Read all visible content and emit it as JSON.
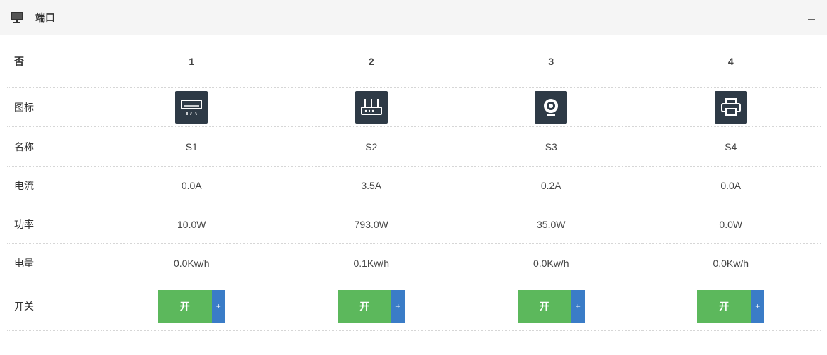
{
  "panel": {
    "title": "端口",
    "header_icon": "monitor-icon",
    "collapse_label": "–"
  },
  "rows": {
    "index": "否",
    "icon": "图标",
    "name": "名称",
    "current": "电流",
    "power": "功率",
    "energy": "电量",
    "switch": "开关"
  },
  "ports": [
    {
      "index": "1",
      "icon": "air-conditioner-icon",
      "name": "S1",
      "current": "0.0A",
      "power": "10.0W",
      "energy": "0.0Kw/h",
      "switch_label": "开",
      "toggle_label": "+"
    },
    {
      "index": "2",
      "icon": "router-icon",
      "name": "S2",
      "current": "3.5A",
      "power": "793.0W",
      "energy": "0.1Kw/h",
      "switch_label": "开",
      "toggle_label": "+"
    },
    {
      "index": "3",
      "icon": "webcam-icon",
      "name": "S3",
      "current": "0.2A",
      "power": "35.0W",
      "energy": "0.0Kw/h",
      "switch_label": "开",
      "toggle_label": "+"
    },
    {
      "index": "4",
      "icon": "printer-icon",
      "name": "S4",
      "current": "0.0A",
      "power": "0.0W",
      "energy": "0.0Kw/h",
      "switch_label": "开",
      "toggle_label": "+"
    }
  ],
  "colors": {
    "switch_on": "#5cb85c",
    "switch_toggle": "#3a7cc7",
    "icon_bg": "#2e3a46"
  }
}
